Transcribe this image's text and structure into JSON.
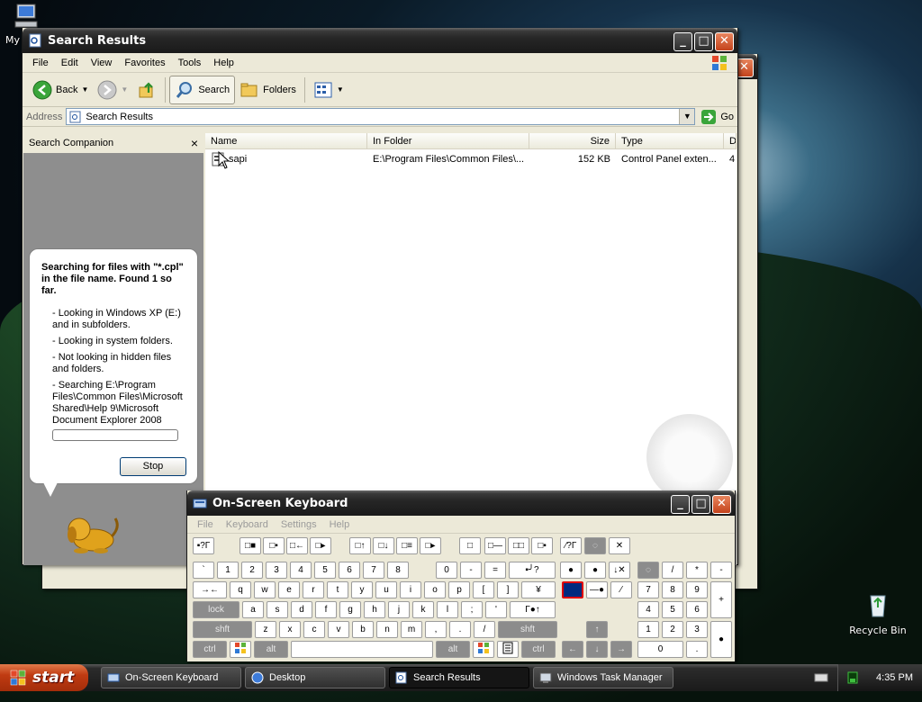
{
  "desktop": {
    "my_computer_label": "My",
    "recycle_bin_label": "Recycle Bin"
  },
  "search_window": {
    "title": "Search Results",
    "menu": [
      "File",
      "Edit",
      "View",
      "Favorites",
      "Tools",
      "Help"
    ],
    "toolbar": {
      "back": "Back",
      "search": "Search",
      "folders": "Folders"
    },
    "address": {
      "label": "Address",
      "value": "Search Results",
      "go": "Go"
    },
    "companion": {
      "title": "Search Companion",
      "close": "×",
      "heading": "Searching for files with \"*.cpl\" in the file name. Found 1 so far.",
      "lines": [
        "- Looking in Windows XP (E:) and in subfolders.",
        "- Looking in system folders.",
        "- Not looking in hidden files and folders.",
        "- Searching E:\\Program Files\\Common Files\\Microsoft Shared\\Help 9\\Microsoft Document Explorer 2008"
      ],
      "stop": "Stop"
    },
    "columns": [
      "Name",
      "In Folder",
      "Size",
      "Type",
      "D"
    ],
    "rows": [
      {
        "name": "sapi",
        "folder": "E:\\Program Files\\Common Files\\...",
        "size": "152 KB",
        "type": "Control Panel exten...",
        "extra": "4"
      }
    ]
  },
  "osk": {
    "title": "On-Screen Keyboard",
    "menu": [
      "File",
      "Keyboard",
      "Settings",
      "Help"
    ],
    "rows": {
      "r0": [
        "▪?Γ",
        "□■",
        "□▪",
        "□←",
        "□▸",
        "□↑",
        "□↓",
        "□≡",
        "□▸",
        "□",
        "□—",
        "□□",
        "□▪",
        "⁄?Γ",
        "◌",
        "✕"
      ],
      "r1": [
        "`",
        "1",
        "2",
        "3",
        "4",
        "5",
        "6",
        "7",
        "8",
        "0",
        "-",
        "=",
        "▪╯?",
        "●",
        "●",
        "↓✕",
        "◌",
        "/",
        "*",
        "-"
      ],
      "r2": [
        "→←",
        "q",
        "w",
        "e",
        "r",
        "t",
        "y",
        "u",
        "i",
        "o",
        "p",
        "[",
        "]",
        "¥",
        "",
        "—●",
        "⁄",
        "7",
        "8",
        "9",
        "+"
      ],
      "r3": [
        "lock",
        "a",
        "s",
        "d",
        "f",
        "g",
        "h",
        "j",
        "k",
        "l",
        ";",
        "'",
        "Γ●↑",
        "4",
        "5",
        "6"
      ],
      "r4": [
        "shft",
        "z",
        "x",
        "c",
        "v",
        "b",
        "n",
        "m",
        ",",
        ".",
        "/",
        "shft",
        "↑",
        "1",
        "2",
        "3"
      ],
      "r5": [
        "ctrl",
        "alt",
        "",
        "alt",
        "ctrl",
        "←",
        "↓",
        "→",
        "0",
        ".",
        "●"
      ]
    }
  },
  "taskbar": {
    "start": "start",
    "tasks": [
      "On-Screen Keyboard",
      "Desktop",
      "Search Results",
      "Windows Task Manager"
    ],
    "time": "4:35 PM"
  },
  "colors": {
    "xp_black_title": "#262626",
    "close_button": "#c4431c",
    "start_button": "#c03b12"
  }
}
